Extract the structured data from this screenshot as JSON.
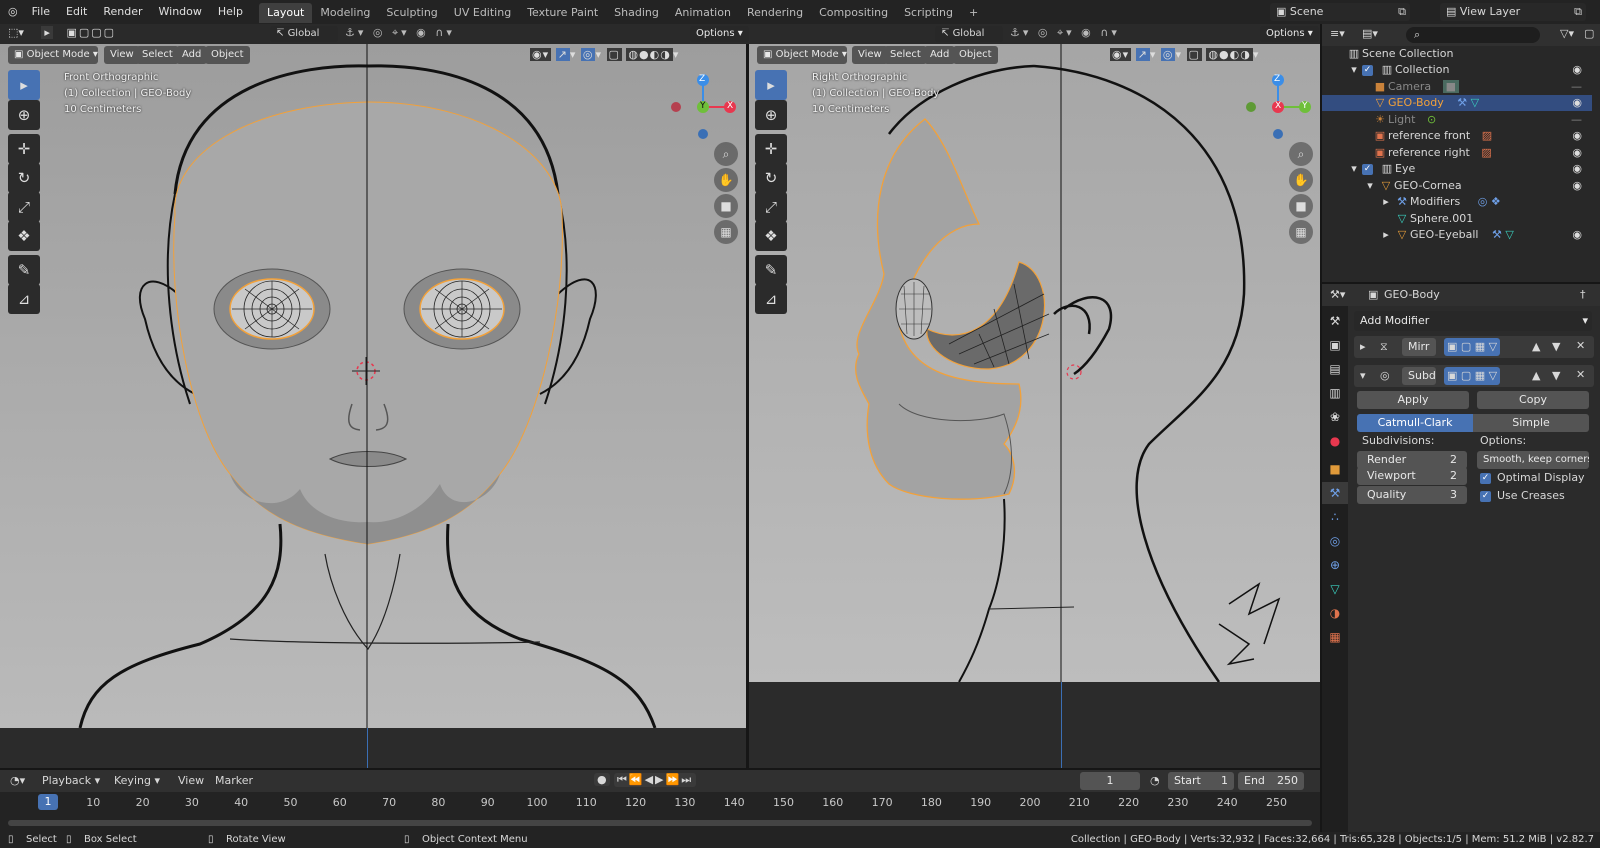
{
  "topbar": {
    "menus": [
      "File",
      "Edit",
      "Render",
      "Window",
      "Help"
    ],
    "workspaces": [
      "Layout",
      "Modeling",
      "Sculpting",
      "UV Editing",
      "Texture Paint",
      "Shading",
      "Animation",
      "Rendering",
      "Compositing",
      "Scripting"
    ],
    "active_workspace": "Layout",
    "add_tab": "+",
    "scene": "Scene",
    "view_layer": "View Layer"
  },
  "viewport_left": {
    "mode": "Object Mode",
    "menus": [
      "View",
      "Select",
      "Add",
      "Object"
    ],
    "orientation": "Global",
    "options": "Options",
    "view_name": "Front Orthographic",
    "collection_info": "(1) Collection | GEO-Body",
    "scale": "10 Centimeters",
    "gizmo": {
      "z": "Z",
      "y": "Y",
      "x": "X"
    }
  },
  "viewport_right": {
    "mode": "Object Mode",
    "menus": [
      "View",
      "Select",
      "Add",
      "Object"
    ],
    "orientation": "Global",
    "options": "Options",
    "view_name": "Right Orthographic",
    "collection_info": "(1) Collection | GEO-Body",
    "scale": "10 Centimeters",
    "gizmo": {
      "z": "Z",
      "y": "Y",
      "x": "X"
    }
  },
  "outliner": {
    "search_placeholder": "",
    "items": [
      {
        "label": "Scene Collection",
        "indent": 0
      },
      {
        "label": "Collection",
        "indent": 1
      },
      {
        "label": "Camera",
        "indent": 2
      },
      {
        "label": "GEO-Body",
        "indent": 2
      },
      {
        "label": "Light",
        "indent": 2
      },
      {
        "label": "reference front",
        "indent": 2
      },
      {
        "label": "reference right",
        "indent": 2
      },
      {
        "label": "Eye",
        "indent": 1
      },
      {
        "label": "GEO-Cornea",
        "indent": 2
      },
      {
        "label": "Modifiers",
        "indent": 3
      },
      {
        "label": "Sphere.001",
        "indent": 3
      },
      {
        "label": "GEO-Eyeball",
        "indent": 3
      }
    ],
    "selected": "GEO-Body"
  },
  "properties": {
    "object_name": "GEO-Body",
    "add_modifier": "Add Modifier",
    "modifiers": [
      {
        "name": "Mirr",
        "expanded": false
      },
      {
        "name": "Subd",
        "expanded": true
      }
    ],
    "apply": "Apply",
    "copy": "Copy",
    "catmull": "Catmull-Clark",
    "simple": "Simple",
    "subdivisions_label": "Subdivisions:",
    "options_label": "Options:",
    "render_label": "Render",
    "render_value": "2",
    "viewport_label": "Viewport",
    "viewport_value": "2",
    "quality_label": "Quality",
    "quality_value": "3",
    "uv_smooth": "Smooth, keep corners",
    "optimal_display": "Optimal Display",
    "use_creases": "Use Creases"
  },
  "timeline": {
    "menus": [
      "Playback",
      "Keying",
      "View",
      "Marker"
    ],
    "current_frame": "1",
    "start_label": "Start",
    "start_value": "1",
    "end_label": "End",
    "end_value": "250",
    "ticks": [
      "10",
      "20",
      "30",
      "40",
      "50",
      "60",
      "70",
      "80",
      "90",
      "100",
      "110",
      "120",
      "130",
      "140",
      "150",
      "160",
      "170",
      "180",
      "190",
      "200",
      "210",
      "220",
      "230",
      "240",
      "250"
    ],
    "cursor_label": "1"
  },
  "statusbar": {
    "select": "Select",
    "box_select": "Box Select",
    "rotate_view": "Rotate View",
    "context_menu": "Object Context Menu",
    "stats": "Collection | GEO-Body | Verts:32,932 | Faces:32,664 | Tris:65,328 | Objects:1/5 | Mem: 51.2 MiB | v2.82.7"
  },
  "colors": {
    "accent": "#4772b3",
    "selection_orange": "#f2a13a",
    "axis_x": "#e8384f",
    "axis_y": "#6fbf3a",
    "axis_z": "#3b8ee8"
  }
}
